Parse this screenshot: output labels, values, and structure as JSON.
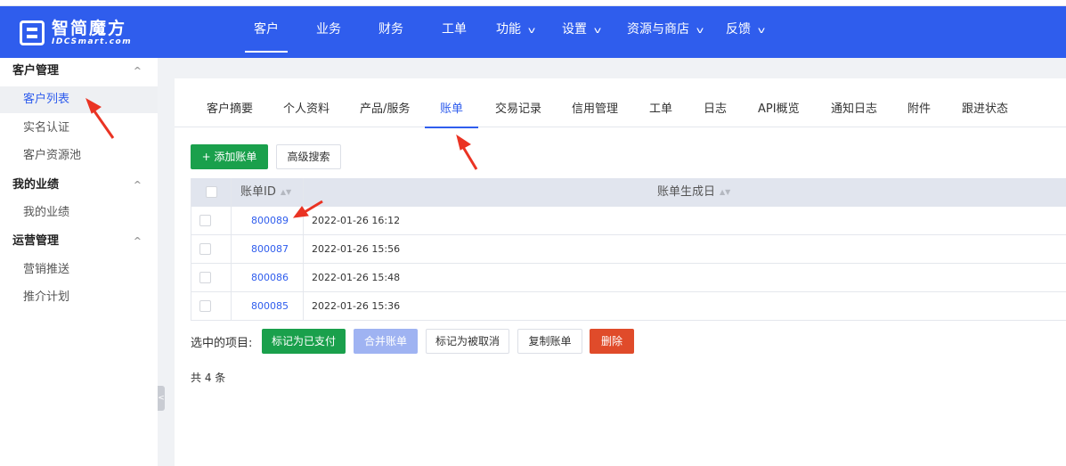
{
  "brand": {
    "name_cn": "智简魔方",
    "name_en": "IDCSmart.com"
  },
  "top_nav": [
    {
      "label": "客户",
      "active": true,
      "has_dropdown": false
    },
    {
      "label": "业务",
      "active": false,
      "has_dropdown": false
    },
    {
      "label": "财务",
      "active": false,
      "has_dropdown": false
    },
    {
      "label": "工单",
      "active": false,
      "has_dropdown": false
    },
    {
      "label": "功能",
      "active": false,
      "has_dropdown": true
    },
    {
      "label": "设置",
      "active": false,
      "has_dropdown": true
    },
    {
      "label": "资源与商店",
      "active": false,
      "has_dropdown": true
    },
    {
      "label": "反馈",
      "active": false,
      "has_dropdown": true
    }
  ],
  "sidebar": {
    "groups": [
      {
        "title": "客户管理",
        "items": [
          "客户列表",
          "实名认证",
          "客户资源池"
        ]
      },
      {
        "title": "我的业绩",
        "items": [
          "我的业绩"
        ]
      },
      {
        "title": "运营管理",
        "items": [
          "营销推送",
          "推介计划"
        ]
      }
    ],
    "active_item": "客户列表"
  },
  "tabs": [
    "客户摘要",
    "个人资料",
    "产品/服务",
    "账单",
    "交易记录",
    "信用管理",
    "工单",
    "日志",
    "API概览",
    "通知日志",
    "附件",
    "跟进状态"
  ],
  "active_tab": "账单",
  "toolbar": {
    "add_label": "+ 添加账单",
    "search_label": "高级搜索"
  },
  "table": {
    "columns": [
      "账单ID",
      "账单生成日"
    ],
    "rows": [
      {
        "id": "800089",
        "date": "2022-01-26 16:12"
      },
      {
        "id": "800087",
        "date": "2022-01-26 15:56"
      },
      {
        "id": "800086",
        "date": "2022-01-26 15:48"
      },
      {
        "id": "800085",
        "date": "2022-01-26 15:36"
      }
    ]
  },
  "bulk_actions": {
    "label": "选中的项目:",
    "buttons": [
      "标记为已支付",
      "合并账单",
      "标记为被取消",
      "复制账单",
      "删除"
    ]
  },
  "total_text": "共 4 条",
  "colors": {
    "nav_bg": "#2f5ded",
    "accent": "#2f5ded",
    "green": "#1aa04c",
    "red": "#e04b2a",
    "annotation": "#ea3323"
  },
  "icons": {
    "sort": "sort-icon",
    "collapse": "chevron-up-icon",
    "dropdown": "chevron-down-icon"
  }
}
